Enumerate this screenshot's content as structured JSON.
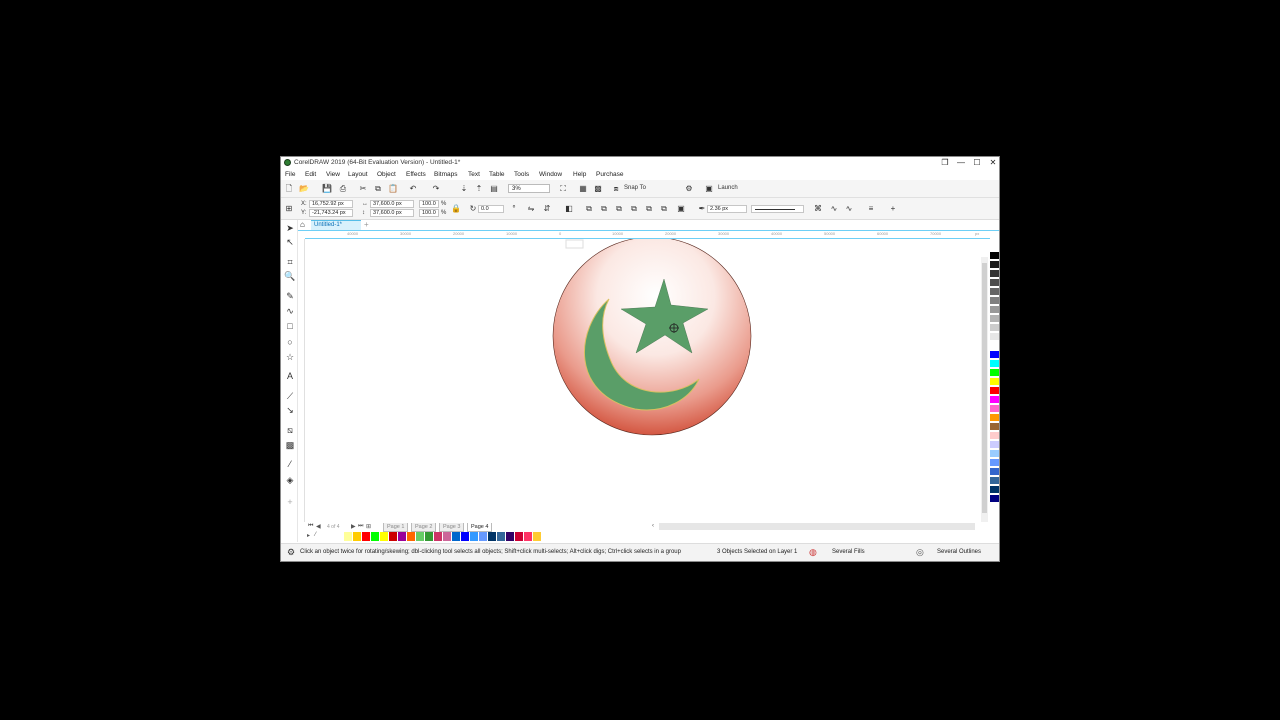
{
  "window": {
    "title": "CorelDRAW 2019 (64-Bit Evaluation Version) - Untitled-1*",
    "controls": {
      "restore_glyph": "❐",
      "minimize_glyph": "—",
      "maximize_glyph": "☐",
      "close_glyph": "✕"
    }
  },
  "menu": [
    "File",
    "Edit",
    "View",
    "Layout",
    "Object",
    "Effects",
    "Bitmaps",
    "Text",
    "Table",
    "Tools",
    "Window",
    "Help",
    "Purchase"
  ],
  "toolbar": {
    "zoom": "3%",
    "snap_to": "Snap To",
    "launch": "Launch"
  },
  "properties": {
    "x_label": "X:",
    "x_value": "16,752.92 px",
    "y_label": "Y:",
    "y_value": "-21,743.24 px",
    "width": "37,600.0 px",
    "height": "37,600.0 px",
    "scale_x": "100.0",
    "scale_y": "100.0",
    "percent": "%",
    "rotation": "0.0",
    "outline_width": "2.36 px"
  },
  "document_tab": "Untitled-1*",
  "ruler_ticks": [
    "40000",
    "30000",
    "20000",
    "10000",
    "0",
    "10000",
    "20000",
    "30000",
    "40000",
    "50000",
    "60000",
    "70000",
    "px"
  ],
  "pages": [
    "Page 1",
    "Page 2",
    "Page 3",
    "Page 4"
  ],
  "page_counter": "4 of 4",
  "status": {
    "hint": "Click an object twice for rotating/skewing; dbl-clicking tool selects all objects; Shift+click multi-selects; Alt+click digs; Ctrl+click selects in a group",
    "selection": "3 Objects Selected on Layer 1",
    "fill": "Several Fills",
    "outline": "Several Outlines"
  },
  "colors": {
    "star": "#5a9e68",
    "crescent": "#5a9e68",
    "crescent_outline": "#d8c060",
    "circle_edge": "#c8341c",
    "accent": "#55bde8"
  },
  "palette": [
    "#000000",
    "#1a1a1a",
    "#333333",
    "#4d4d4d",
    "#666666",
    "#808080",
    "#999999",
    "#b3b3b3",
    "#cccccc",
    "#e6e6e6",
    "#ffffff",
    "#0000ff",
    "#00ffff",
    "#00ff00",
    "#ffff00",
    "#ff0000",
    "#ff00ff",
    "#ff66cc",
    "#ff9900",
    "#996633",
    "#ffcccc",
    "#ccccff",
    "#99ccff",
    "#6699ff",
    "#3366cc",
    "#336699",
    "#003366",
    "#000080"
  ],
  "doc_palette": [
    "#ffffff",
    "#ffff99",
    "#ffcc00",
    "#ff0000",
    "#00ff00",
    "#ffff00",
    "#cc0000",
    "#990099",
    "#ff6600",
    "#66cc66",
    "#339933",
    "#cc3366",
    "#cc6699",
    "#0066cc",
    "#0000ff",
    "#3399ff",
    "#6699ff",
    "#003366",
    "#336699",
    "#330066",
    "#cc0033",
    "#ff3366",
    "#ffcc33"
  ]
}
